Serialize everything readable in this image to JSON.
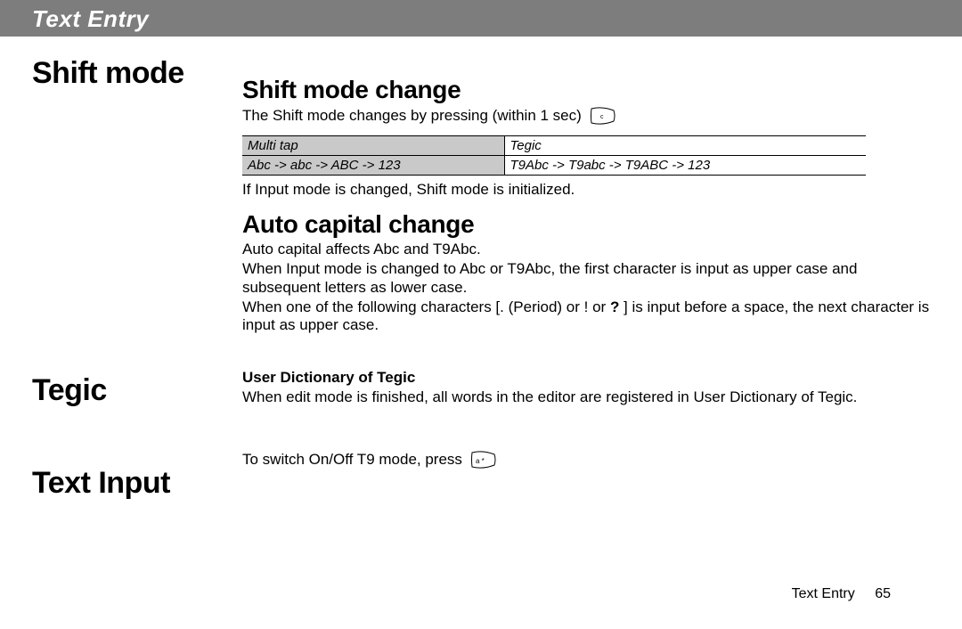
{
  "header": {
    "title": "Text Entry"
  },
  "left": {
    "shift": "Shift mode",
    "tegic": "Tegic",
    "textinput": "Text Input"
  },
  "shift_section": {
    "h2": "Shift mode change",
    "intro": "The Shift mode changes by pressing (within 1 sec)",
    "table": {
      "head_left": "Multi tap",
      "head_right": "Tegic",
      "row_left": "Abc -> abc -> ABC -> 123",
      "row_right": "T9Abc -> T9abc -> T9ABC -> 123"
    },
    "note": "If Input mode is changed, Shift mode is initialized."
  },
  "auto_section": {
    "h2": "Auto capital change",
    "p1": "Auto capital affects Abc and T9Abc.",
    "p2": "When Input mode is changed to Abc or T9Abc, the first character is input as upper case and subsequent letters as lower case.",
    "p3_a": "When one of the following characters [",
    "p3_b": ". (Period) or ! or ",
    "p3_q": "?",
    "p3_c": " ] is input before a space, the next character is input as upper case."
  },
  "tegic_section": {
    "sub": "User Dictionary of Tegic",
    "p": "When edit mode is finished, all words in the editor are registered in User Dictionary of Tegic."
  },
  "textinput_section": {
    "p": "To switch On/Off T9 mode, press"
  },
  "icons": {
    "key1": "clear-key-icon",
    "key2": "star-key-icon"
  },
  "footer": {
    "label": "Text Entry",
    "page": "65"
  }
}
